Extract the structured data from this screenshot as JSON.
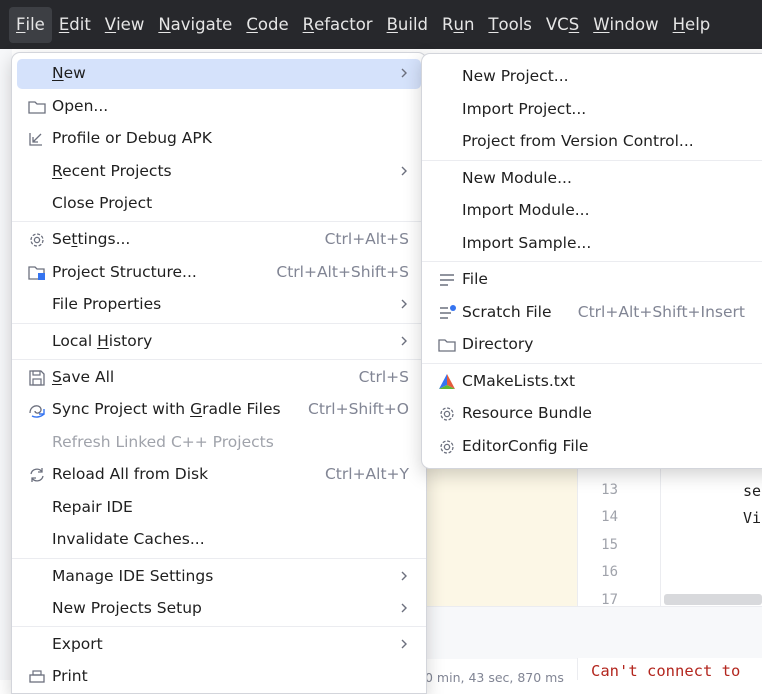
{
  "menubar": {
    "items": [
      {
        "pre": "",
        "ul": "F",
        "post": "ile"
      },
      {
        "pre": "",
        "ul": "E",
        "post": "dit"
      },
      {
        "pre": "",
        "ul": "V",
        "post": "iew"
      },
      {
        "pre": "",
        "ul": "N",
        "post": "avigate"
      },
      {
        "pre": "",
        "ul": "C",
        "post": "ode"
      },
      {
        "pre": "",
        "ul": "R",
        "post": "efactor"
      },
      {
        "pre": "",
        "ul": "B",
        "post": "uild"
      },
      {
        "pre": "R",
        "ul": "u",
        "post": "n"
      },
      {
        "pre": "",
        "ul": "T",
        "post": "ools"
      },
      {
        "pre": "VC",
        "ul": "S",
        "post": ""
      },
      {
        "pre": "",
        "ul": "W",
        "post": "indow"
      },
      {
        "pre": "",
        "ul": "H",
        "post": "elp"
      }
    ]
  },
  "file_menu": {
    "new": {
      "ul": "N",
      "post": "ew"
    },
    "open": "Open...",
    "profile_debug": "Profile or Debug APK",
    "recent_projects": {
      "ul": "R",
      "post": "ecent Projects"
    },
    "close_project": "Close Project",
    "settings": {
      "pre": "Se",
      "ul": "t",
      "post": "tings...",
      "shortcut": "Ctrl+Alt+S"
    },
    "project_structure": {
      "label": "Project Structure...",
      "shortcut": "Ctrl+Alt+Shift+S"
    },
    "file_properties": "File Properties",
    "local_history": {
      "pre": "Local ",
      "ul": "H",
      "post": "istory"
    },
    "save_all": {
      "ul": "S",
      "post": "ave All",
      "shortcut": "Ctrl+S"
    },
    "sync_gradle": {
      "pre": "Sync Project with ",
      "ul": "G",
      "post": "radle Files",
      "shortcut": "Ctrl+Shift+O"
    },
    "refresh_cpp": "Refresh Linked C++ Projects",
    "reload_disk": {
      "label": "Reload All from Disk",
      "shortcut": "Ctrl+Alt+Y"
    },
    "repair_ide": "Repair IDE",
    "invalidate_caches": "Invalidate Caches...",
    "manage_ide_settings": "Manage IDE Settings",
    "new_projects_setup": "New Projects Setup",
    "export": "Export",
    "print": "Print"
  },
  "new_menu": {
    "new_project": "New Project...",
    "import_project": "Import Project...",
    "project_vcs": "Project from Version Control...",
    "new_module": "New Module...",
    "import_module": "Import Module...",
    "import_sample": "Import Sample...",
    "file": "File",
    "scratch_file": {
      "label": "Scratch File",
      "shortcut": "Ctrl+Alt+Shift+Insert"
    },
    "directory": "Directory",
    "cmakelists": "CMakeLists.txt",
    "resource_bundle": "Resource Bundle",
    "editorconfig": "EditorConfig File"
  },
  "editor": {
    "line_numbers": [
      "13",
      "14",
      "15",
      "16",
      "17"
    ],
    "code_13": "se",
    "code_14": "Vi"
  },
  "console": {
    "text": "Can't connect to"
  },
  "status": {
    "fragment": "0 min, 43 sec, 870 ms"
  }
}
